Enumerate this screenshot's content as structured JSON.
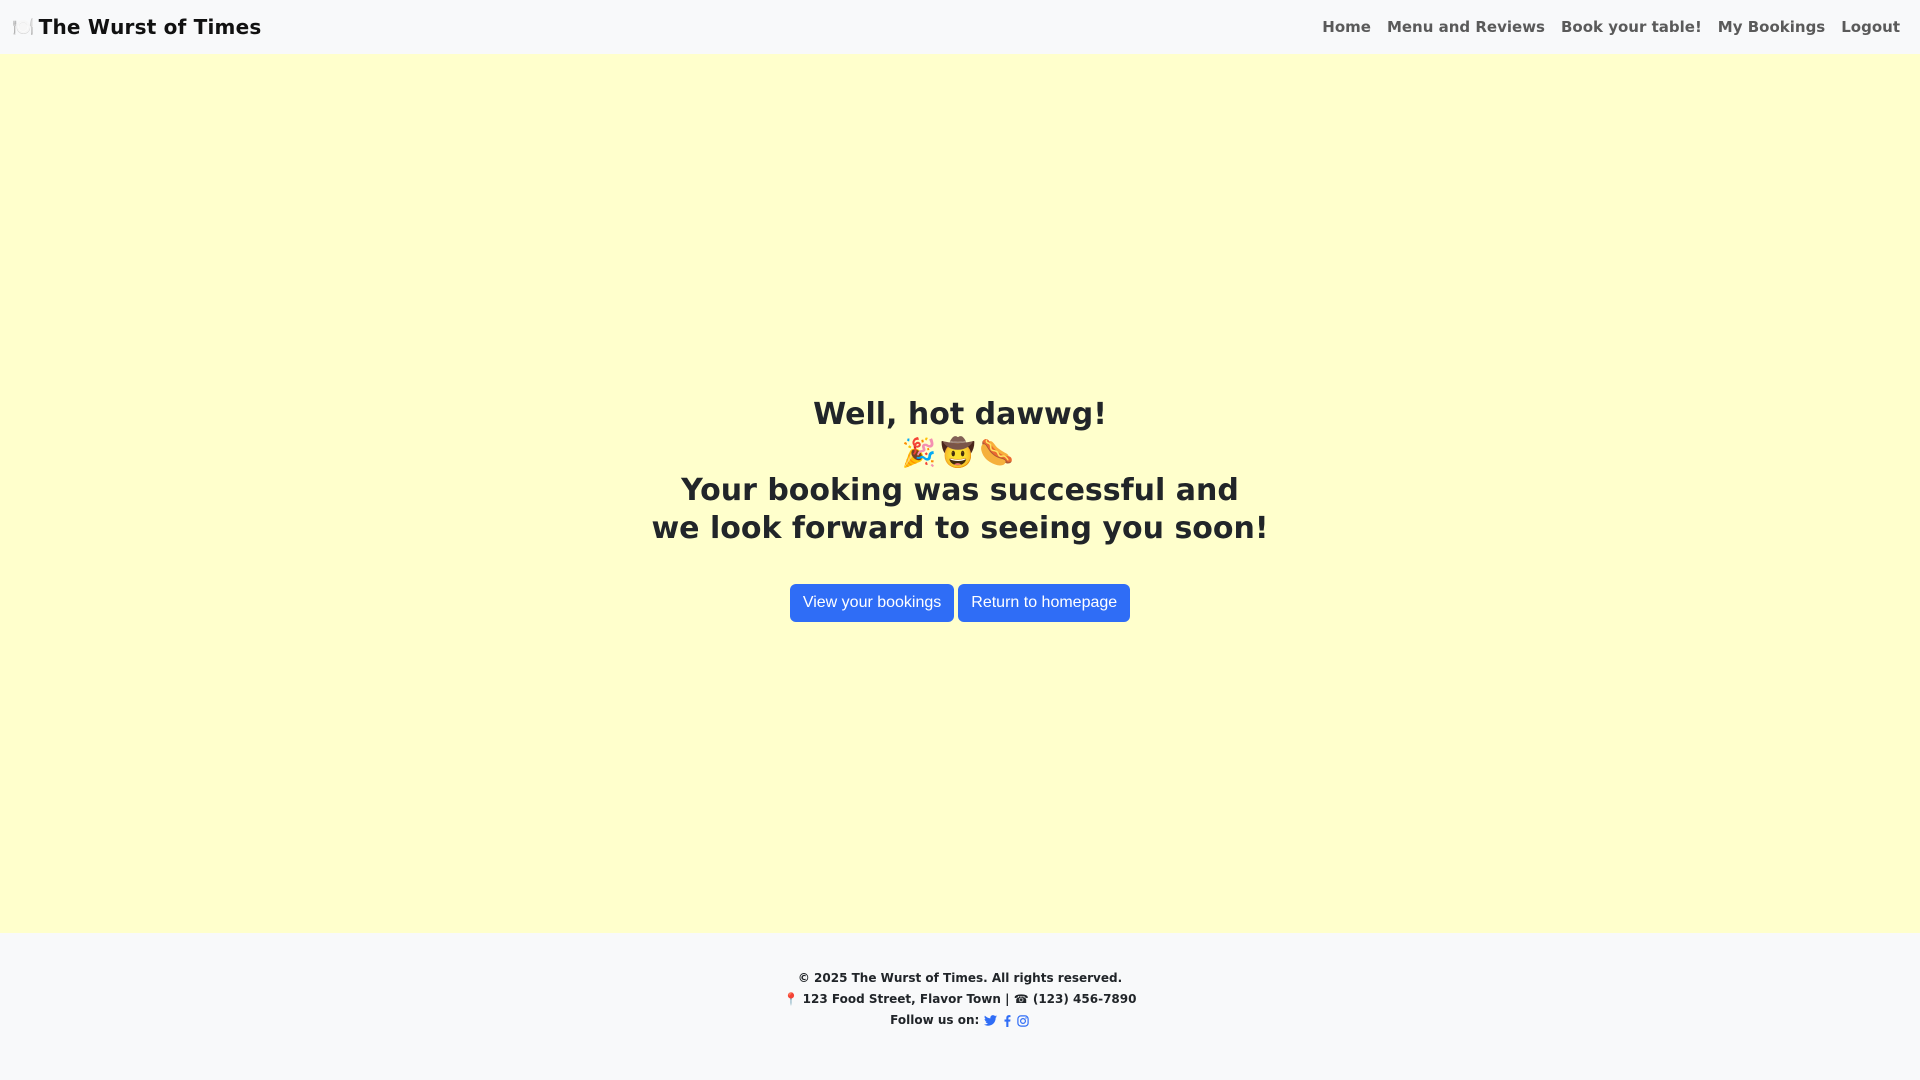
{
  "navbar": {
    "brand_icon": "🍽️",
    "brand_name": "The Wurst of Times",
    "links": [
      {
        "label": "Home"
      },
      {
        "label": "Menu and Reviews"
      },
      {
        "label": "Book your table!"
      },
      {
        "label": "My Bookings"
      },
      {
        "label": "Logout"
      }
    ]
  },
  "main": {
    "headline": "Well, hot dawwg!",
    "emojis": "🎉🤠🌭",
    "message_line1": "Your booking was successful and",
    "message_line2": "we look forward to seeing you soon!",
    "buttons": {
      "view_bookings": "View your bookings",
      "homepage": "Return to homepage"
    }
  },
  "footer": {
    "copyright": "© 2025 The Wurst of Times. All rights reserved.",
    "pin_icon": "📍",
    "address": "123 Food Street, Flavor Town",
    "separator": "|",
    "phone_icon": "☎",
    "phone": "(123) 456-7890",
    "follow_label": "Follow us on:",
    "social_icons": [
      "twitter-icon",
      "facebook-icon",
      "instagram-icon"
    ]
  },
  "colors": {
    "navbar_bg": "#f8f9fa",
    "main_bg": "#ffffcc",
    "button_bg": "#2f6df6",
    "text": "#212529"
  }
}
